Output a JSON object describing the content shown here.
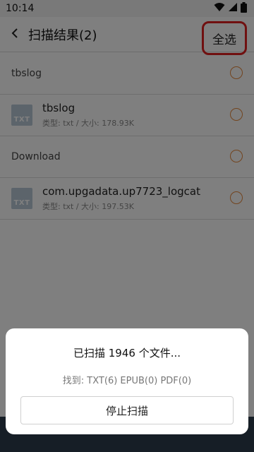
{
  "status_bar": {
    "time": "10:14"
  },
  "header": {
    "title": "扫描结果(2)",
    "select_all_label": "全选"
  },
  "list": {
    "groups": [
      {
        "name": "tbslog",
        "files": [
          {
            "thumb_label": "TXT",
            "name": "tbslog",
            "meta": "类型: txt / 大小: 178.93K"
          }
        ]
      },
      {
        "name": "Download",
        "files": [
          {
            "thumb_label": "TXT",
            "name": "com.upgadata.up7723_logcat",
            "meta": "类型: txt / 大小: 197.53K"
          }
        ]
      }
    ]
  },
  "dialog": {
    "title": "已扫描 1946 个文件...",
    "found": "找到: TXT(6) EPUB(0) PDF(0)",
    "stop_label": "停止扫描"
  },
  "colors": {
    "accent_radio": "#e4883c",
    "highlight": "#e02020",
    "bottom_strip": "#2c3d4c"
  }
}
